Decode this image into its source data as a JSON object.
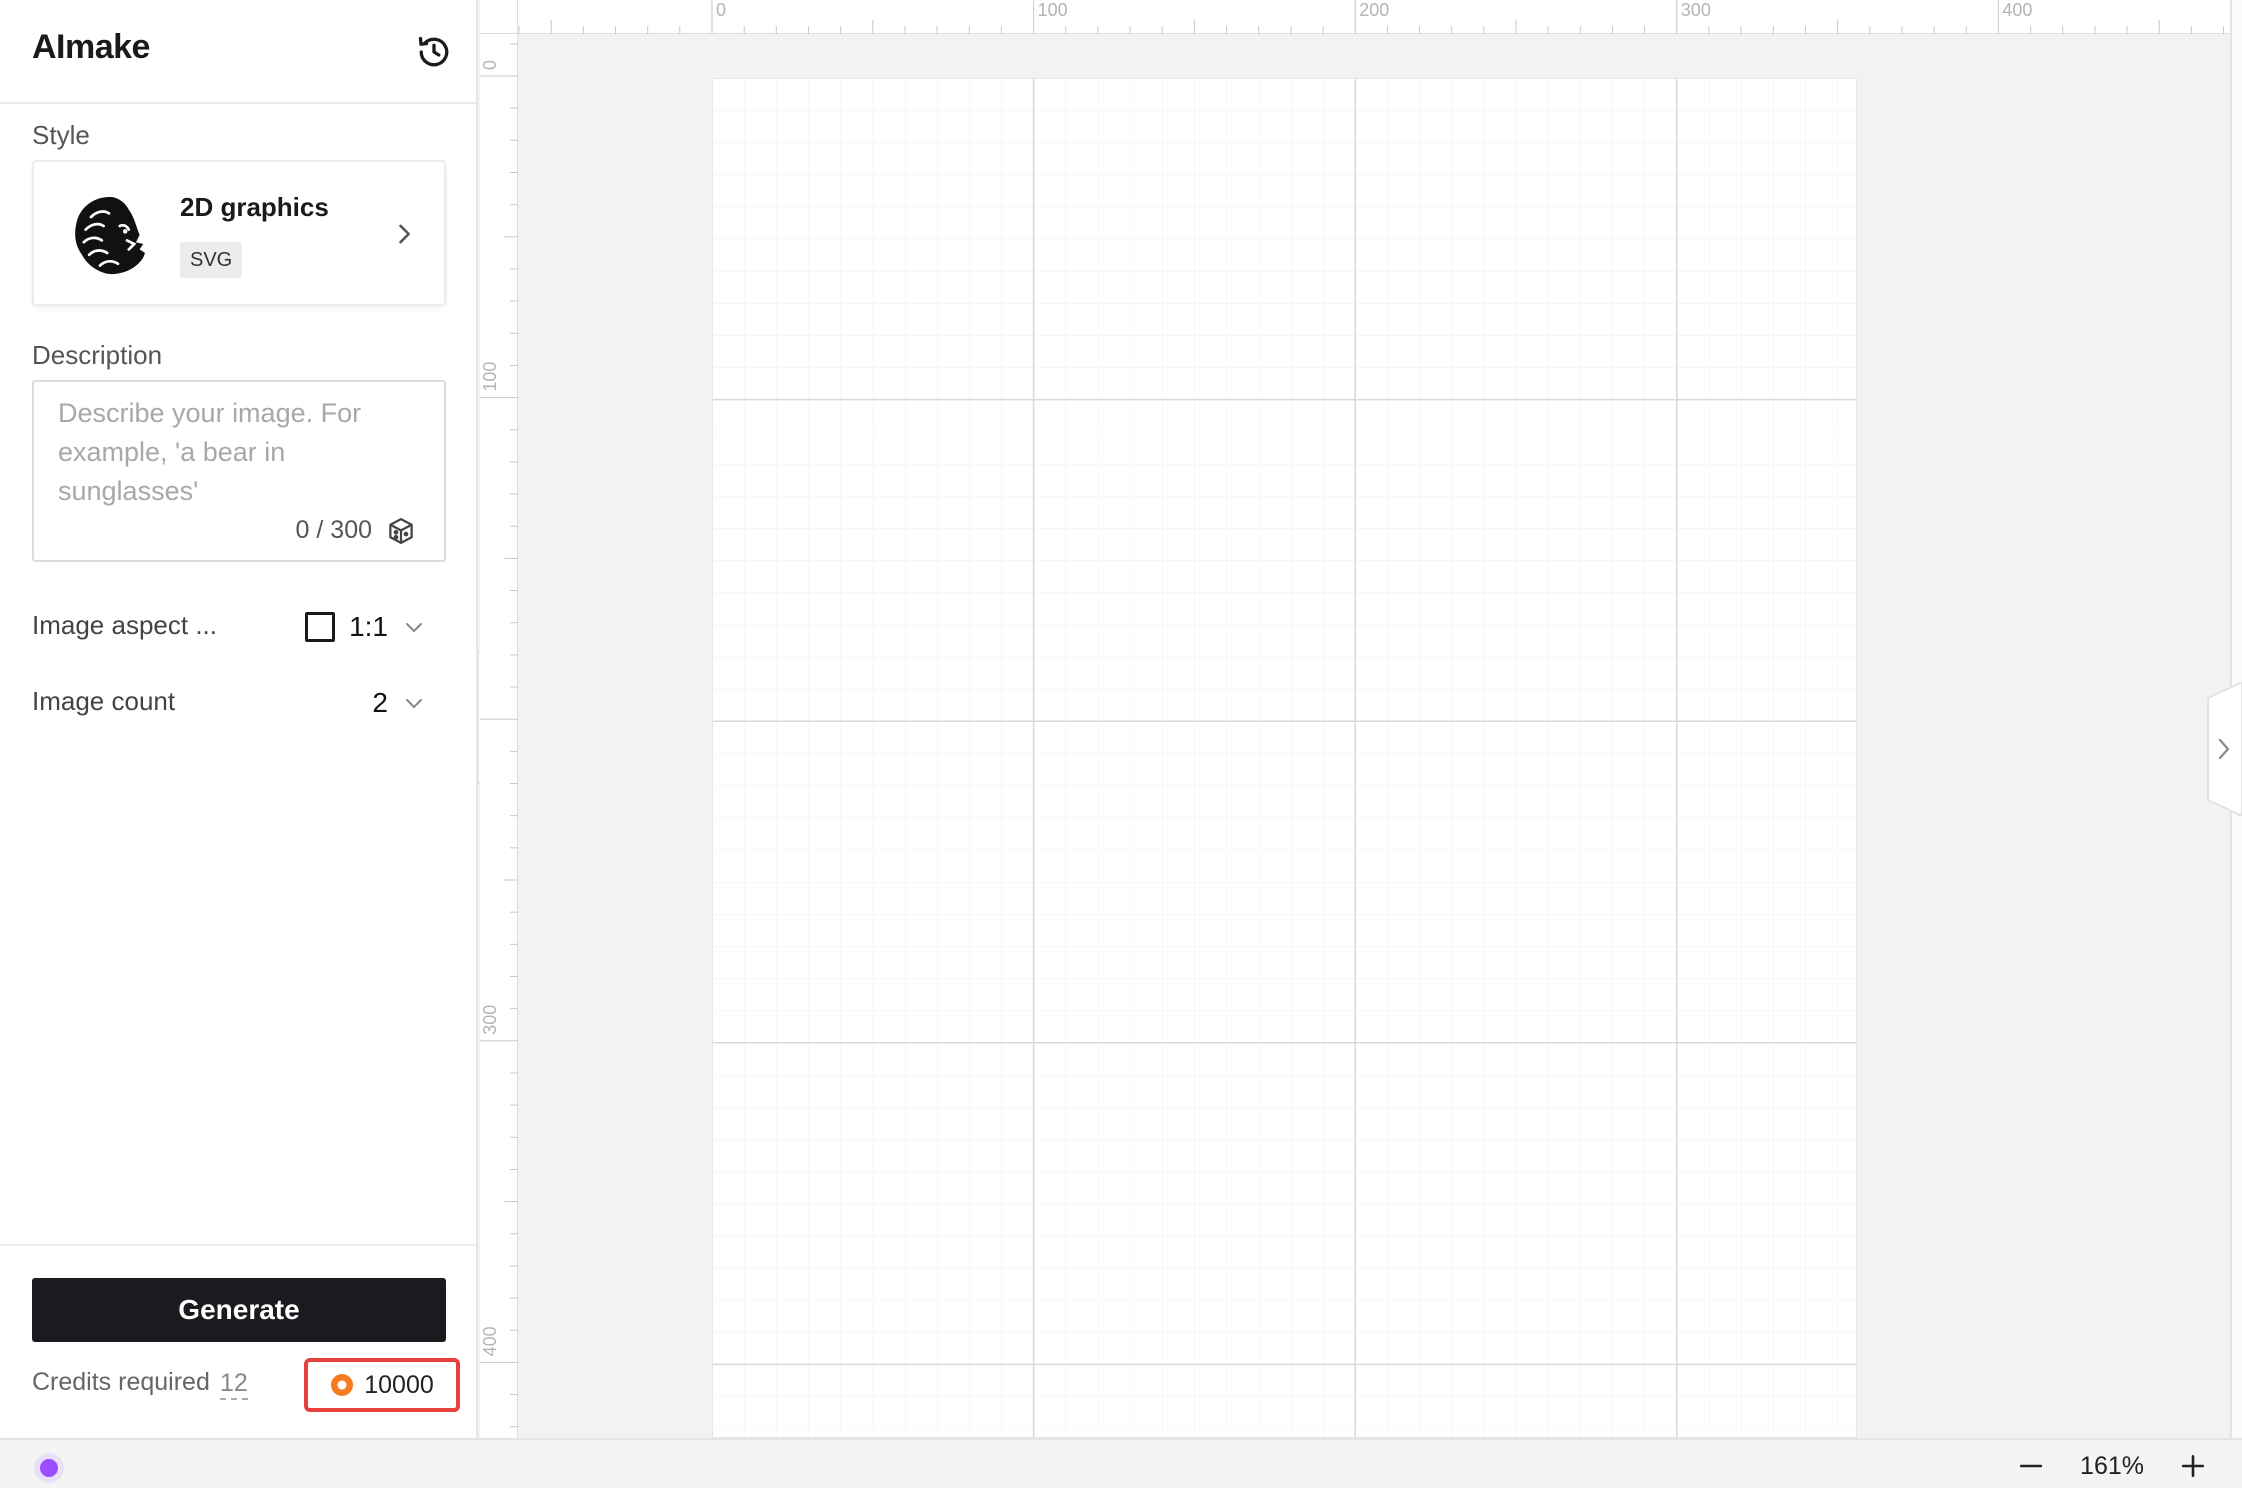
{
  "app": {
    "title": "AImake"
  },
  "sidebar": {
    "style_label": "Style",
    "style": {
      "name": "2D graphics",
      "badge": "SVG",
      "thumb_icon": "lion-head-icon"
    },
    "description_label": "Description",
    "description": {
      "value": "",
      "placeholder": "Describe your image. For example, 'a bear in sunglasses'",
      "counter": "0 / 300"
    },
    "aspect": {
      "label": "Image aspect ...",
      "value": "1:1"
    },
    "count": {
      "label": "Image count",
      "value": "2"
    },
    "generate_label": "Generate",
    "credits": {
      "label": "Credits required",
      "value": "12",
      "balance": "10000"
    }
  },
  "rulers": {
    "top_labels": [
      "0",
      "100",
      "200",
      "300",
      "400"
    ],
    "left_labels": [
      "0",
      "100",
      "300",
      "400"
    ]
  },
  "zoom": {
    "value": "161%",
    "decrease_icon": "minus-icon",
    "increase_icon": "plus-icon"
  },
  "colors": {
    "accent": "#1b1b1f",
    "highlight": "#e8403a",
    "coin": "#f47b20",
    "status": "#9b4dff"
  }
}
